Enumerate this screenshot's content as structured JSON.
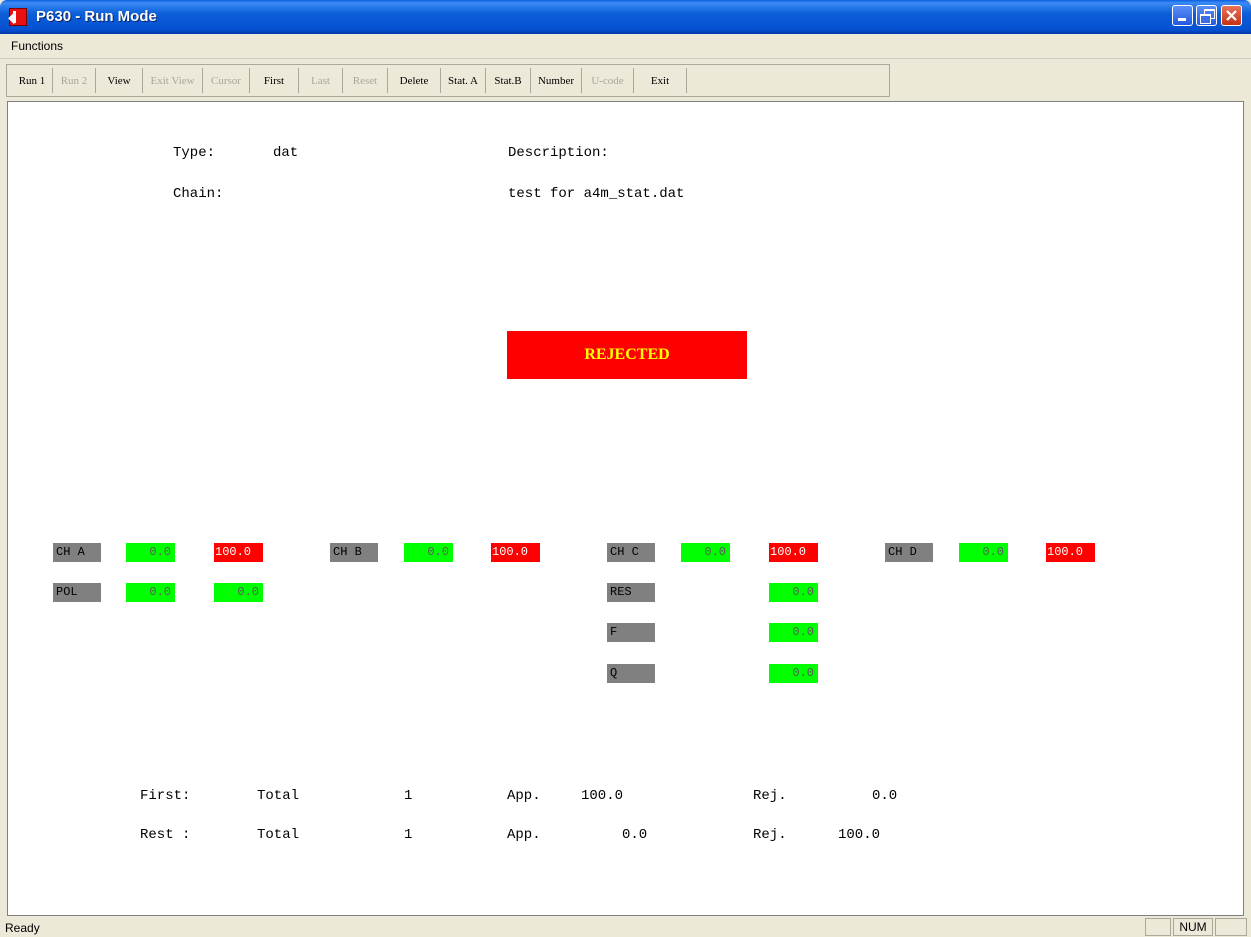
{
  "window": {
    "title": "P630 - Run Mode"
  },
  "menu": {
    "items": [
      "Functions"
    ]
  },
  "toolbar": {
    "buttons": [
      {
        "label": "Run 1",
        "enabled": true
      },
      {
        "label": "Run 2",
        "enabled": false
      },
      {
        "label": "View",
        "enabled": true
      },
      {
        "label": "Exit View",
        "enabled": false
      },
      {
        "label": "Cursor",
        "enabled": false
      },
      {
        "label": "First",
        "enabled": true
      },
      {
        "label": "Last",
        "enabled": false
      },
      {
        "label": "Reset",
        "enabled": false
      },
      {
        "label": "Delete",
        "enabled": true
      },
      {
        "label": "Stat. A",
        "enabled": true
      },
      {
        "label": "Stat.B",
        "enabled": true
      },
      {
        "label": "Number",
        "enabled": true
      },
      {
        "label": "U-code",
        "enabled": false
      },
      {
        "label": "Exit",
        "enabled": true
      }
    ]
  },
  "info": {
    "type_label": "Type:",
    "type_value": "dat",
    "chain_label": "Chain:",
    "description_label": "Description:",
    "description_value": "test for a4m_stat.dat"
  },
  "result": {
    "status": "REJECTED",
    "status_color": "#ff0000",
    "text_color": "#ffff00"
  },
  "channels": {
    "a": {
      "label": "CH A",
      "low": "0.0",
      "high": "100.0"
    },
    "b": {
      "label": "CH B",
      "low": "0.0",
      "high": "100.0"
    },
    "c": {
      "label": "CH C",
      "low": "0.0",
      "high": "100.0"
    },
    "d": {
      "label": "CH D",
      "low": "0.0",
      "high": "100.0"
    },
    "pol": {
      "label": "POL",
      "v1": "0.0",
      "v2": "0.0"
    },
    "res": {
      "label": "RES",
      "value": "0.0"
    },
    "f": {
      "label": "F",
      "value": "0.0"
    },
    "q": {
      "label": "Q",
      "value": "0.0"
    }
  },
  "stats": {
    "first": {
      "label": "First:",
      "total_label": "Total",
      "total": "1",
      "app_label": "App.",
      "app": "100.0",
      "rej_label": "Rej.",
      "rej": "0.0"
    },
    "rest": {
      "label": "Rest :",
      "total_label": "Total",
      "total": "1",
      "app_label": "App.",
      "app": "0.0",
      "rej_label": "Rej.",
      "rej": "100.0"
    }
  },
  "statusbar": {
    "text": "Ready",
    "num": "NUM"
  },
  "colors": {
    "ok": "#00ff00",
    "fail": "#ff0000",
    "label_bg": "#808080"
  }
}
